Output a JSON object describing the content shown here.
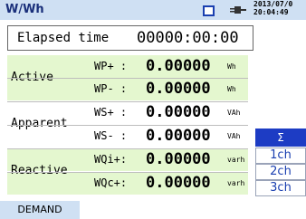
{
  "header": {
    "title": "W/Wh",
    "datetime_line1": "2013/07/0",
    "datetime_line2": "20:04:49"
  },
  "elapsed": {
    "label": "Elapsed time",
    "value": "00000:00:00"
  },
  "groups": [
    {
      "label": "Active",
      "rows": [
        {
          "symbol": "WP+ :",
          "value": "0.00000",
          "unit": "Wh"
        },
        {
          "symbol": "WP- :",
          "value": "0.00000",
          "unit": "Wh"
        }
      ]
    },
    {
      "label": "Apparent",
      "rows": [
        {
          "symbol": "WS+ :",
          "value": "0.00000",
          "unit": "VAh"
        },
        {
          "symbol": "WS- :",
          "value": "0.00000",
          "unit": "VAh"
        }
      ]
    },
    {
      "label": "Reactive",
      "rows": [
        {
          "symbol": "WQi+:",
          "value": "0.00000",
          "unit": "varh"
        },
        {
          "symbol": "WQc+:",
          "value": "0.00000",
          "unit": "varh"
        }
      ]
    }
  ],
  "channel_menu": {
    "sigma": "Σ",
    "items": [
      "1ch",
      "2ch",
      "3ch"
    ]
  },
  "footer": {
    "demand_label": "DEMAND"
  },
  "colors": {
    "header_bg": "#cfe0f3",
    "green_row": "#e4f7cf",
    "accent": "#1d3cc4"
  },
  "icons": {
    "memory": "memory-card-icon",
    "power": "power-plug-icon"
  }
}
